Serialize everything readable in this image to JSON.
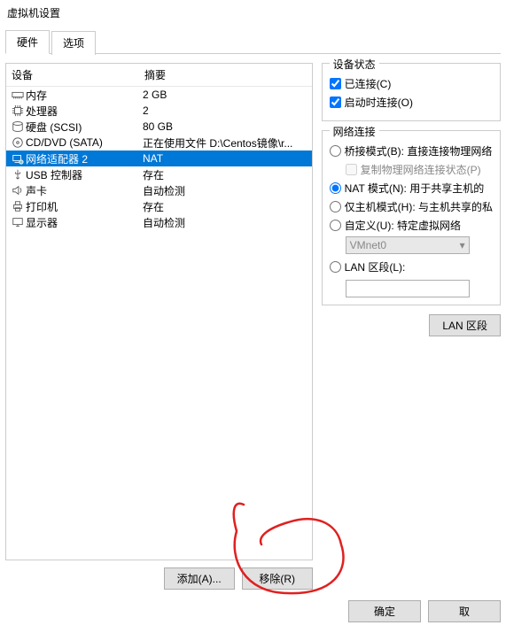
{
  "window": {
    "title": "虚拟机设置"
  },
  "tabs": {
    "hardware": "硬件",
    "options": "选项"
  },
  "list": {
    "header_device": "设备",
    "header_summary": "摘要",
    "rows": [
      {
        "name": "内存",
        "summary": "2 GB"
      },
      {
        "name": "处理器",
        "summary": "2"
      },
      {
        "name": "硬盘 (SCSI)",
        "summary": "80 GB"
      },
      {
        "name": "CD/DVD (SATA)",
        "summary": "正在使用文件 D:\\Centos镜像\\r..."
      },
      {
        "name": "网络适配器 2",
        "summary": "NAT"
      },
      {
        "name": "USB 控制器",
        "summary": "存在"
      },
      {
        "name": "声卡",
        "summary": "自动检测"
      },
      {
        "name": "打印机",
        "summary": "存在"
      },
      {
        "name": "显示器",
        "summary": "自动检测"
      }
    ]
  },
  "buttons": {
    "add": "添加(A)...",
    "remove": "移除(R)",
    "ok": "确定",
    "cancel": "取",
    "lan_segments": "LAN 区段"
  },
  "status": {
    "group_title": "设备状态",
    "connected": "已连接(C)",
    "connect_at_poweron": "启动时连接(O)"
  },
  "network": {
    "group_title": "网络连接",
    "bridged": "桥接模式(B): 直接连接物理网络",
    "replicate": "复制物理网络连接状态(P)",
    "nat": "NAT 模式(N): 用于共享主机的",
    "hostonly": "仅主机模式(H): 与主机共享的私",
    "custom": "自定义(U): 特定虚拟网络",
    "custom_value": "VMnet0",
    "lan": "LAN 区段(L):",
    "lan_value": ""
  }
}
